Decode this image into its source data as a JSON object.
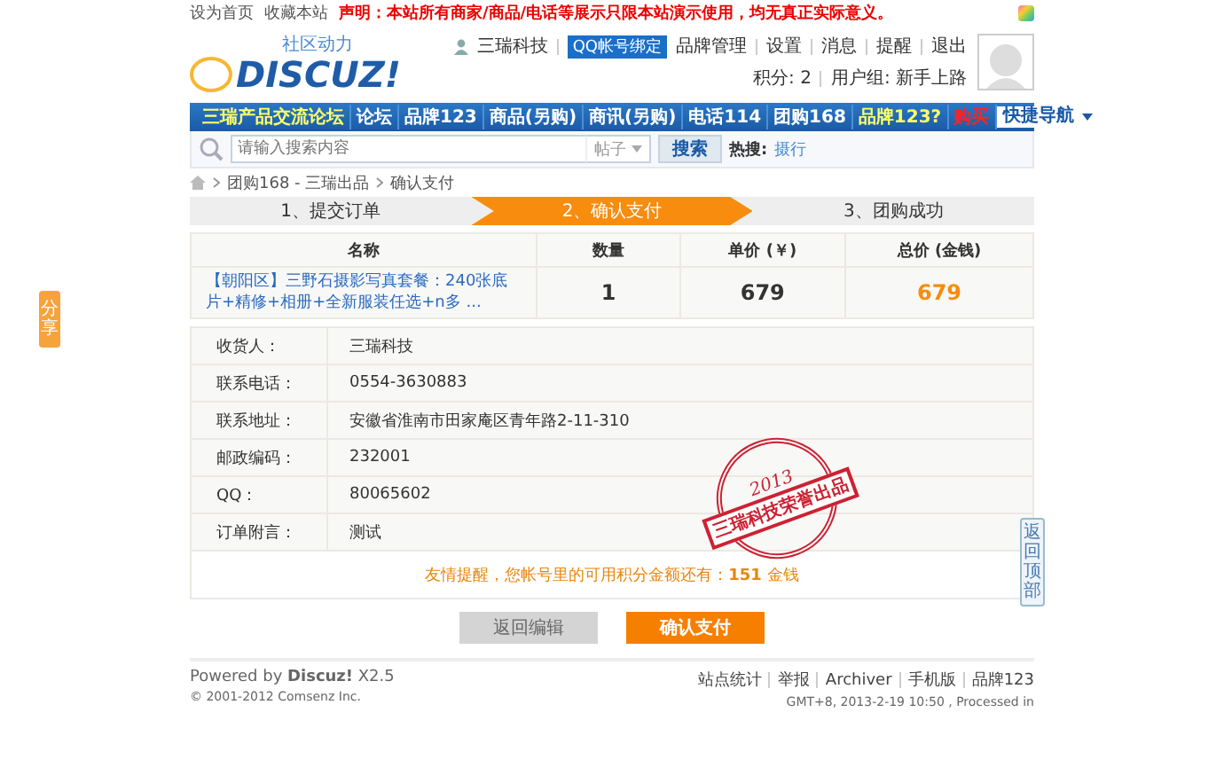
{
  "top_bar": {
    "links": [
      "设为首页",
      "收藏本站"
    ],
    "notice": "声明：本站所有商家/商品/电话等展示只限本站演示使用，均无真正实际意义。"
  },
  "logo": {
    "tagline": "社区动力",
    "wordmark": "DISCUZ!"
  },
  "user": {
    "name": "三瑞科技",
    "qq_bind": "QQ帐号绑定",
    "links": [
      "品牌管理",
      "设置",
      "消息",
      "提醒",
      "退出"
    ],
    "points": "积分: 2",
    "group": "用户组: 新手上路"
  },
  "nav": {
    "items": [
      {
        "label": "三瑞产品交流论坛",
        "color": "#ffff66"
      },
      {
        "label": "论坛",
        "color": "#ffffff"
      },
      {
        "label": "品牌123",
        "color": "#ffffff"
      },
      {
        "label": "商品(另购)",
        "color": "#ffffff"
      },
      {
        "label": "商讯(另购)",
        "color": "#ffffff"
      },
      {
        "label": "电话114",
        "color": "#ffffff"
      },
      {
        "label": "团购168",
        "color": "#ffffff"
      },
      {
        "label": "品牌123?",
        "color": "#ffff66"
      },
      {
        "label": "购买",
        "color": "#ff2222"
      }
    ],
    "quick_nav": "快捷导航"
  },
  "search": {
    "placeholder": "请输入搜索内容",
    "scope": "帖子",
    "button": "搜索",
    "hot_label": "热搜:",
    "hot": [
      "摄行"
    ]
  },
  "breadcrumb": [
    "团购168 - 三瑞出品",
    "确认支付"
  ],
  "steps": [
    {
      "label": "1、提交订单",
      "selected": false
    },
    {
      "label": "2、确认支付",
      "selected": true
    },
    {
      "label": "3、团购成功",
      "selected": false
    }
  ],
  "order_table": {
    "columns": [
      "名称",
      "数量",
      "单价 (￥)",
      "总价 (金钱)"
    ],
    "row": {
      "name": "【朝阳区】三野石摄影写真套餐：240张底片+精修+相册+全新服装任选+n多 ...",
      "quantity": "1",
      "unit_price": "679",
      "total": "679"
    }
  },
  "details": [
    {
      "label": "收货人：",
      "value": "三瑞科技"
    },
    {
      "label": "联系电话：",
      "value": "0554-3630883"
    },
    {
      "label": "联系地址：",
      "value": "安徽省淮南市田家庵区青年路2-11-310"
    },
    {
      "label": "邮政编码：",
      "value": "232001"
    },
    {
      "label": "QQ：",
      "value": "80065602"
    },
    {
      "label": "订单附言：",
      "value": "测试"
    }
  ],
  "stamp": {
    "year": "2013",
    "text": "三瑞科技荣誉出品"
  },
  "notice": "友情提醒，您帐号里的可用积分金额还有：**151** 金钱",
  "buttons": [
    {
      "label": "返回编辑",
      "kind": "secondary"
    },
    {
      "label": "确认支付",
      "kind": "primary"
    }
  ],
  "footer": {
    "powered": "Powered by **Discuz!** X2.5",
    "copyright": "© 2001-2012 Comsenz Inc.",
    "links": [
      "站点统计",
      "举报",
      "Archiver",
      "手机版",
      "品牌123"
    ],
    "time": "GMT+8, 2013-2-19 10:50 , Processed in"
  },
  "share_tab": "分享",
  "back_top": "返回顶部"
}
